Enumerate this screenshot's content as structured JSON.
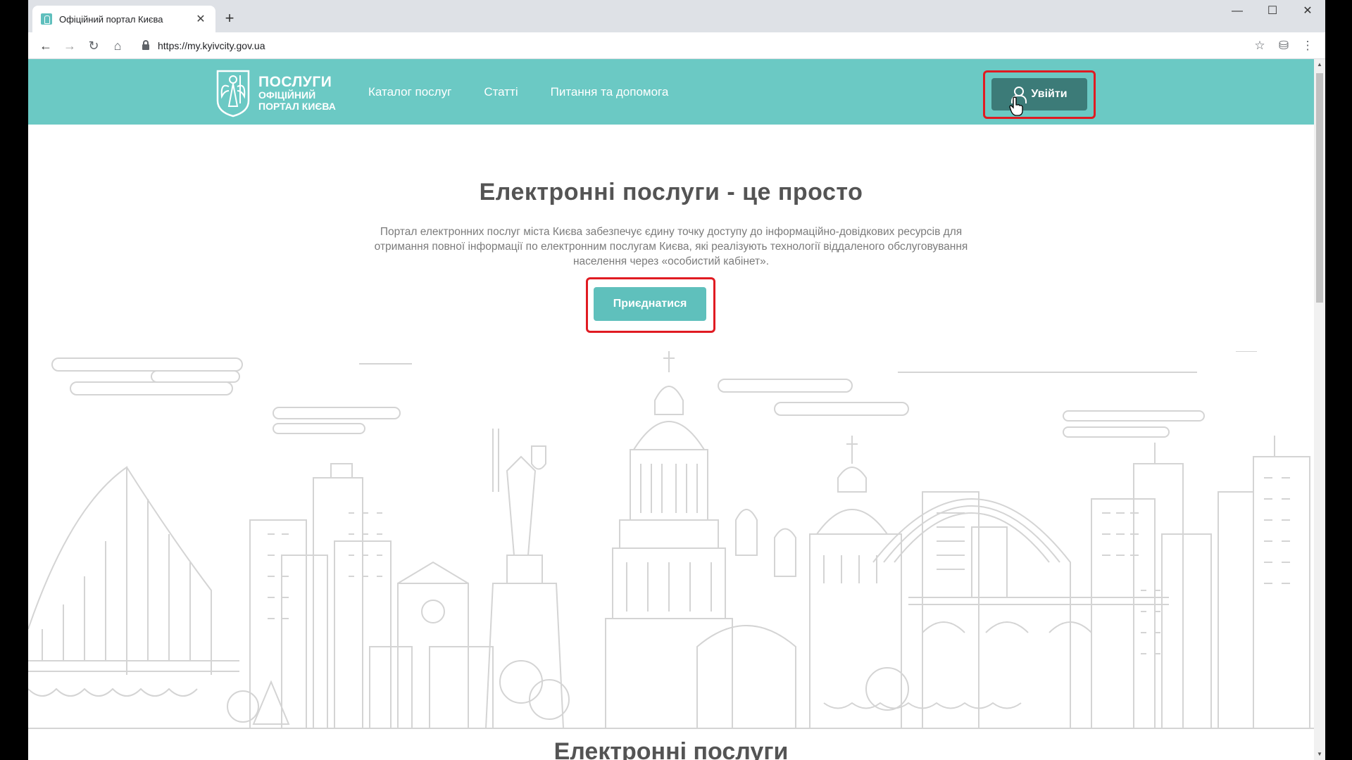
{
  "browser": {
    "tab_title": "Офіційний портал Києва",
    "tab_close_icon": "close-icon",
    "new_tab_label": "+",
    "url": "https://my.kyivcity.gov.ua",
    "window_controls": {
      "minimize": "—",
      "maximize": "☐",
      "close": "✕"
    },
    "nav": {
      "back": "←",
      "forward": "→",
      "reload": "↻",
      "home": "⌂"
    },
    "bookmark_star": "☆",
    "extension": "⛁",
    "menu": "⋮"
  },
  "header": {
    "logo": {
      "line1": "ПОСЛУГИ",
      "line2": "ОФІЦІЙНИЙ",
      "line3": "ПОРТАЛ КИЄВА"
    },
    "nav_items": [
      {
        "label": "Каталог послуг"
      },
      {
        "label": "Статті"
      },
      {
        "label": "Питання та допомога"
      }
    ],
    "login_label": "Увійти"
  },
  "hero": {
    "title": "Електронні послуги - це просто",
    "description": "Портал електронних послуг міста Києва забезпечує єдину точку доступу до інформаційно-довідкових ресурсів для отримання повної інформації по електронним послугам Києва, які реалізують технології віддаленого обслуговування населення через «особистий кабінет».",
    "join_label": "Приєднатися"
  },
  "section": {
    "title": "Електронні послуги"
  },
  "colors": {
    "header": "#6bc9c4",
    "login_button": "#3c7b78",
    "join_button": "#5fc0bc",
    "highlight": "#e01b22",
    "skyline": "#d4d4d4"
  }
}
